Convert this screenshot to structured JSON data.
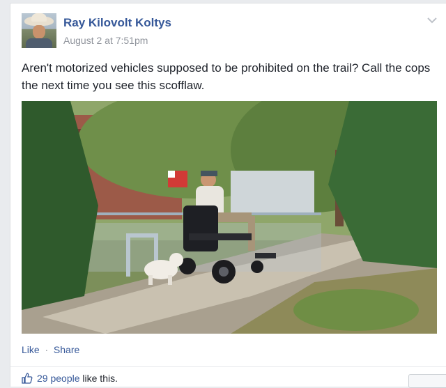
{
  "post": {
    "author": "Ray Kilovolt Koltys",
    "timestamp": "August 2 at 7:51pm",
    "text": "Aren't motorized vehicles supposed to be prohibited on the trail? Call the cops the next time you see this scofflaw.",
    "photo_icon": "photo",
    "menu_icon": "chevron-down-icon"
  },
  "actions": {
    "like_label": "Like",
    "separator": "·",
    "share_label": "Share"
  },
  "likes": {
    "icon": "thumbs-up-icon",
    "count_text": "29 people",
    "suffix": " like this."
  },
  "colors": {
    "link": "#365899",
    "background": "#e9ebee",
    "card": "#ffffff",
    "meta": "#90949c"
  }
}
